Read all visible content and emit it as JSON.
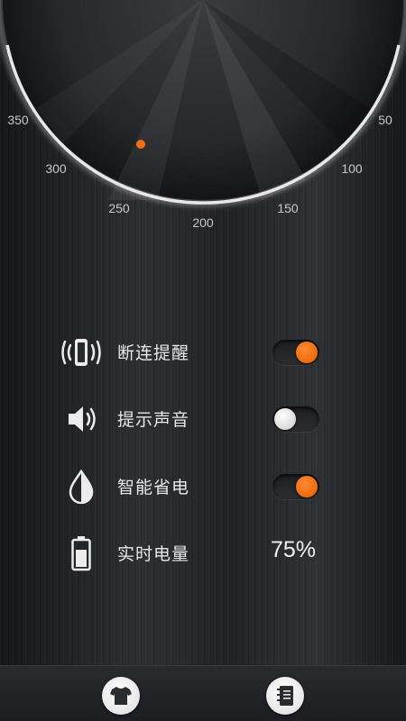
{
  "dial": {
    "labels": [
      "350",
      "300",
      "250",
      "200",
      "150",
      "100",
      "50"
    ],
    "accent_color": "#f26b0f"
  },
  "settings": [
    {
      "id": "disconnect-alert",
      "icon": "vibrate-phone-icon",
      "label": "断连提醒",
      "control": "toggle",
      "on": true
    },
    {
      "id": "alert-sound",
      "icon": "speaker-icon",
      "label": "提示声音",
      "control": "toggle",
      "on": false
    },
    {
      "id": "power-saving",
      "icon": "water-drop-icon",
      "label": "智能省电",
      "control": "toggle",
      "on": true
    },
    {
      "id": "battery-level",
      "icon": "battery-icon",
      "label": "实时电量",
      "control": "value",
      "value": "75%"
    }
  ],
  "bottom_bar": {
    "left_icon": "tshirt-icon",
    "right_icon": "notebook-icon"
  }
}
